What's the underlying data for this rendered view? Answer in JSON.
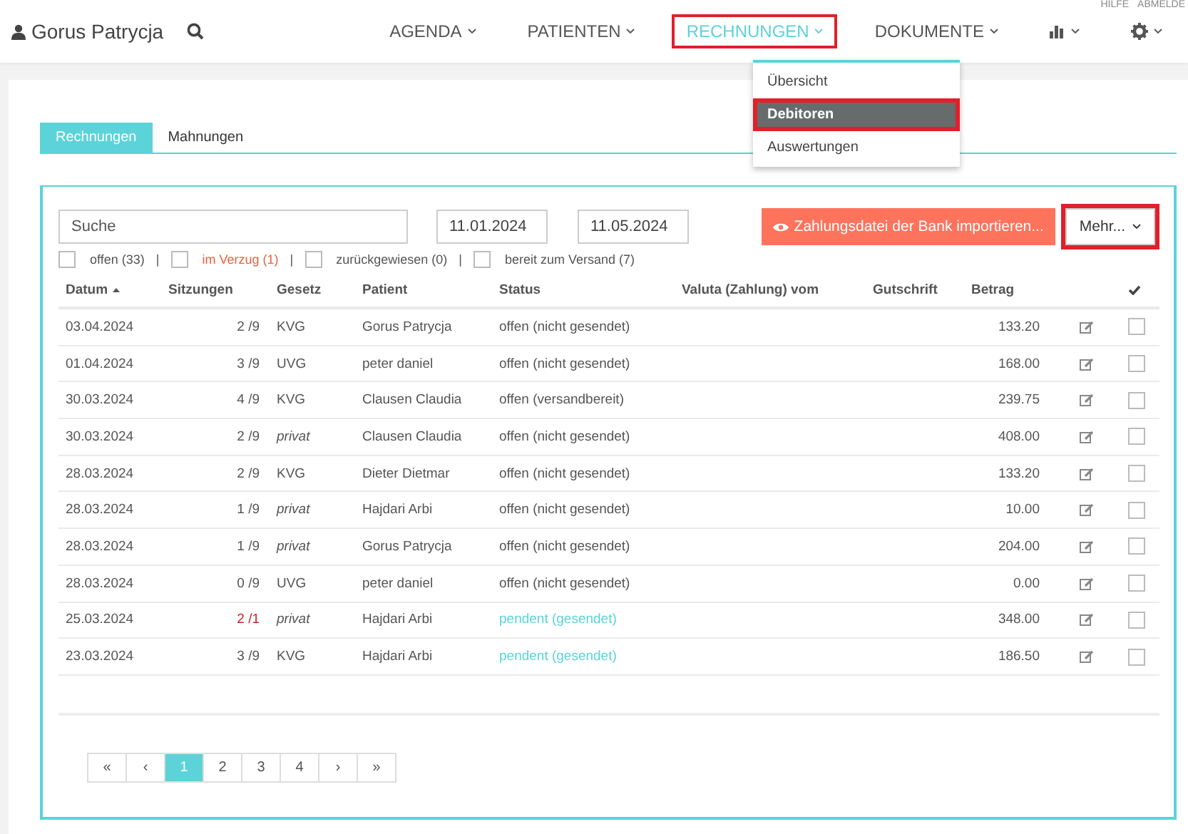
{
  "top_links": [
    "HILFE",
    "ABMELDE"
  ],
  "user": {
    "name": "Gorus Patrycja"
  },
  "nav": [
    {
      "label": "AGENDA",
      "kind": "text",
      "selected": false,
      "highlighted": false
    },
    {
      "label": "PATIENTEN",
      "kind": "text",
      "selected": false,
      "highlighted": false
    },
    {
      "label": "RECHNUNGEN",
      "kind": "text",
      "selected": true,
      "highlighted": true
    },
    {
      "label": "DOKUMENTE",
      "kind": "text",
      "selected": false,
      "highlighted": false
    },
    {
      "kind": "chart",
      "selected": false,
      "highlighted": false
    },
    {
      "kind": "gear",
      "selected": false,
      "highlighted": false
    }
  ],
  "menu": [
    {
      "label": "Übersicht",
      "selected": false,
      "highlighted": false
    },
    {
      "label": "Debitoren",
      "selected": true,
      "highlighted": true
    },
    {
      "label": "Auswertungen",
      "selected": false,
      "highlighted": false
    }
  ],
  "tabs": [
    {
      "label": "Rechnungen",
      "selected": true
    },
    {
      "label": "Mahnungen",
      "selected": false
    }
  ],
  "search": {
    "placeholder": "Suche"
  },
  "date_from": "11.01.2024",
  "date_to": "11.05.2024",
  "import_button": "Zahlungsdatei der Bank importieren...",
  "more_button": {
    "label": "Mehr...",
    "highlighted": true
  },
  "filters": [
    {
      "label": "offen (33)",
      "checked": false,
      "warning": false
    },
    {
      "label": "im Verzug (1)",
      "checked": false,
      "warning": true
    },
    {
      "label": "zurückgewiesen (0)",
      "checked": false,
      "warning": false
    },
    {
      "label": "bereit zum Versand (7)",
      "checked": false,
      "warning": false
    }
  ],
  "filter_separator": "|",
  "columns": [
    "Datum",
    "Sitzungen",
    "Gesetz",
    "Patient",
    "Status",
    "Valuta (Zahlung) vom",
    "Gutschrift",
    "Betrag"
  ],
  "rows": [
    {
      "date": "03.04.2024",
      "sessions": "2 /9",
      "overdue": false,
      "law": "KVG",
      "law_italic": false,
      "patient": "Gorus Patrycja",
      "status": "offen (nicht gesendet)",
      "pending": false,
      "amount": "133.20",
      "checked": false
    },
    {
      "date": "01.04.2024",
      "sessions": "3 /9",
      "overdue": false,
      "law": "UVG",
      "law_italic": false,
      "patient": "peter daniel",
      "status": "offen (nicht gesendet)",
      "pending": false,
      "amount": "168.00",
      "checked": false
    },
    {
      "date": "30.03.2024",
      "sessions": "4 /9",
      "overdue": false,
      "law": "KVG",
      "law_italic": false,
      "patient": "Clausen Claudia",
      "status": "offen (versandbereit)",
      "pending": false,
      "amount": "239.75",
      "checked": false
    },
    {
      "date": "30.03.2024",
      "sessions": "2 /9",
      "overdue": false,
      "law": "privat",
      "law_italic": true,
      "patient": "Clausen Claudia",
      "status": "offen (nicht gesendet)",
      "pending": false,
      "amount": "408.00",
      "checked": false
    },
    {
      "date": "28.03.2024",
      "sessions": "2 /9",
      "overdue": false,
      "law": "KVG",
      "law_italic": false,
      "patient": "Dieter Dietmar",
      "status": "offen (nicht gesendet)",
      "pending": false,
      "amount": "133.20",
      "checked": false
    },
    {
      "date": "28.03.2024",
      "sessions": "1 /9",
      "overdue": false,
      "law": "privat",
      "law_italic": true,
      "patient": "Hajdari Arbi",
      "status": "offen (nicht gesendet)",
      "pending": false,
      "amount": "10.00",
      "checked": false
    },
    {
      "date": "28.03.2024",
      "sessions": "1 /9",
      "overdue": false,
      "law": "privat",
      "law_italic": true,
      "patient": "Gorus Patrycja",
      "status": "offen (nicht gesendet)",
      "pending": false,
      "amount": "204.00",
      "checked": false
    },
    {
      "date": "28.03.2024",
      "sessions": "0 /9",
      "overdue": false,
      "law": "UVG",
      "law_italic": false,
      "patient": "peter daniel",
      "status": "offen (nicht gesendet)",
      "pending": false,
      "amount": "0.00",
      "checked": false
    },
    {
      "date": "25.03.2024",
      "sessions": "2 /1",
      "overdue": true,
      "law": "privat",
      "law_italic": true,
      "patient": "Hajdari Arbi",
      "status": "pendent (gesendet)",
      "pending": true,
      "amount": "348.00",
      "checked": false
    },
    {
      "date": "23.03.2024",
      "sessions": "3 /9",
      "overdue": false,
      "law": "KVG",
      "law_italic": false,
      "patient": "Hajdari Arbi",
      "status": "pendent (gesendet)",
      "pending": true,
      "amount": "186.50",
      "checked": false
    }
  ],
  "pagination": [
    {
      "label": "«",
      "selected": false
    },
    {
      "label": "‹",
      "selected": false
    },
    {
      "label": "1",
      "selected": true
    },
    {
      "label": "2",
      "selected": false
    },
    {
      "label": "3",
      "selected": false
    },
    {
      "label": "4",
      "selected": false
    },
    {
      "label": "›",
      "selected": false
    },
    {
      "label": "»",
      "selected": false
    }
  ]
}
